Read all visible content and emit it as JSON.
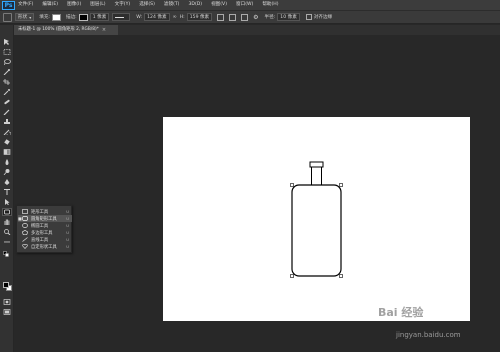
{
  "app": {
    "logo": "Ps"
  },
  "menu": {
    "items": [
      "文件(F)",
      "编辑(E)",
      "图像(I)",
      "图层(L)",
      "文字(Y)",
      "选择(S)",
      "滤镜(T)",
      "3D(D)",
      "视图(V)",
      "窗口(W)",
      "帮助(H)"
    ]
  },
  "options_bar": {
    "mode": "形状",
    "fill_label": "填充:",
    "stroke_label": "描边:",
    "stroke_width": "1 像素",
    "w_label": "W:",
    "w_value": "124 像素",
    "h_label": "H:",
    "h_value": "159 像素",
    "radius_label": "半径:",
    "radius_value": "10 像素",
    "align_edges": "对齐边缘",
    "fill_color": "#ffffff",
    "stroke_color": "#000000"
  },
  "document": {
    "tab_title": "未标题-1 @ 100% (圆角矩形 2, RGB/8)",
    "tab_close": "×",
    "modified_mark": "*"
  },
  "flyout": {
    "items": [
      {
        "label": "矩形工具",
        "key": "U",
        "icon": "rectangle-icon",
        "selected": false
      },
      {
        "label": "圆角矩形工具",
        "key": "U",
        "icon": "rounded-rectangle-icon",
        "selected": true
      },
      {
        "label": "椭圆工具",
        "key": "U",
        "icon": "ellipse-icon",
        "selected": false
      },
      {
        "label": "多边形工具",
        "key": "U",
        "icon": "polygon-icon",
        "selected": false
      },
      {
        "label": "直线工具",
        "key": "U",
        "icon": "line-icon",
        "selected": false
      },
      {
        "label": "自定形状工具",
        "key": "U",
        "icon": "custom-shape-icon",
        "selected": false
      }
    ]
  },
  "tools": [
    "move-icon",
    "marquee-icon",
    "lasso-icon",
    "quick-select-icon",
    "crop-icon",
    "eyedropper-icon",
    "healing-brush-icon",
    "brush-icon",
    "clone-stamp-icon",
    "history-brush-icon",
    "eraser-icon",
    "gradient-icon",
    "blur-icon",
    "dodge-icon",
    "pen-icon",
    "type-icon",
    "path-select-icon",
    "shape-icon",
    "hand-icon",
    "zoom-icon",
    "more-tools-icon"
  ],
  "colors": {
    "foreground": "#000000",
    "background": "#ffffff",
    "canvas": "#ffffff",
    "workspace": "#282828",
    "accent": "#31a8ff"
  },
  "watermark": {
    "text": "Bai 经验",
    "url": "jingyan.baidu.com"
  }
}
